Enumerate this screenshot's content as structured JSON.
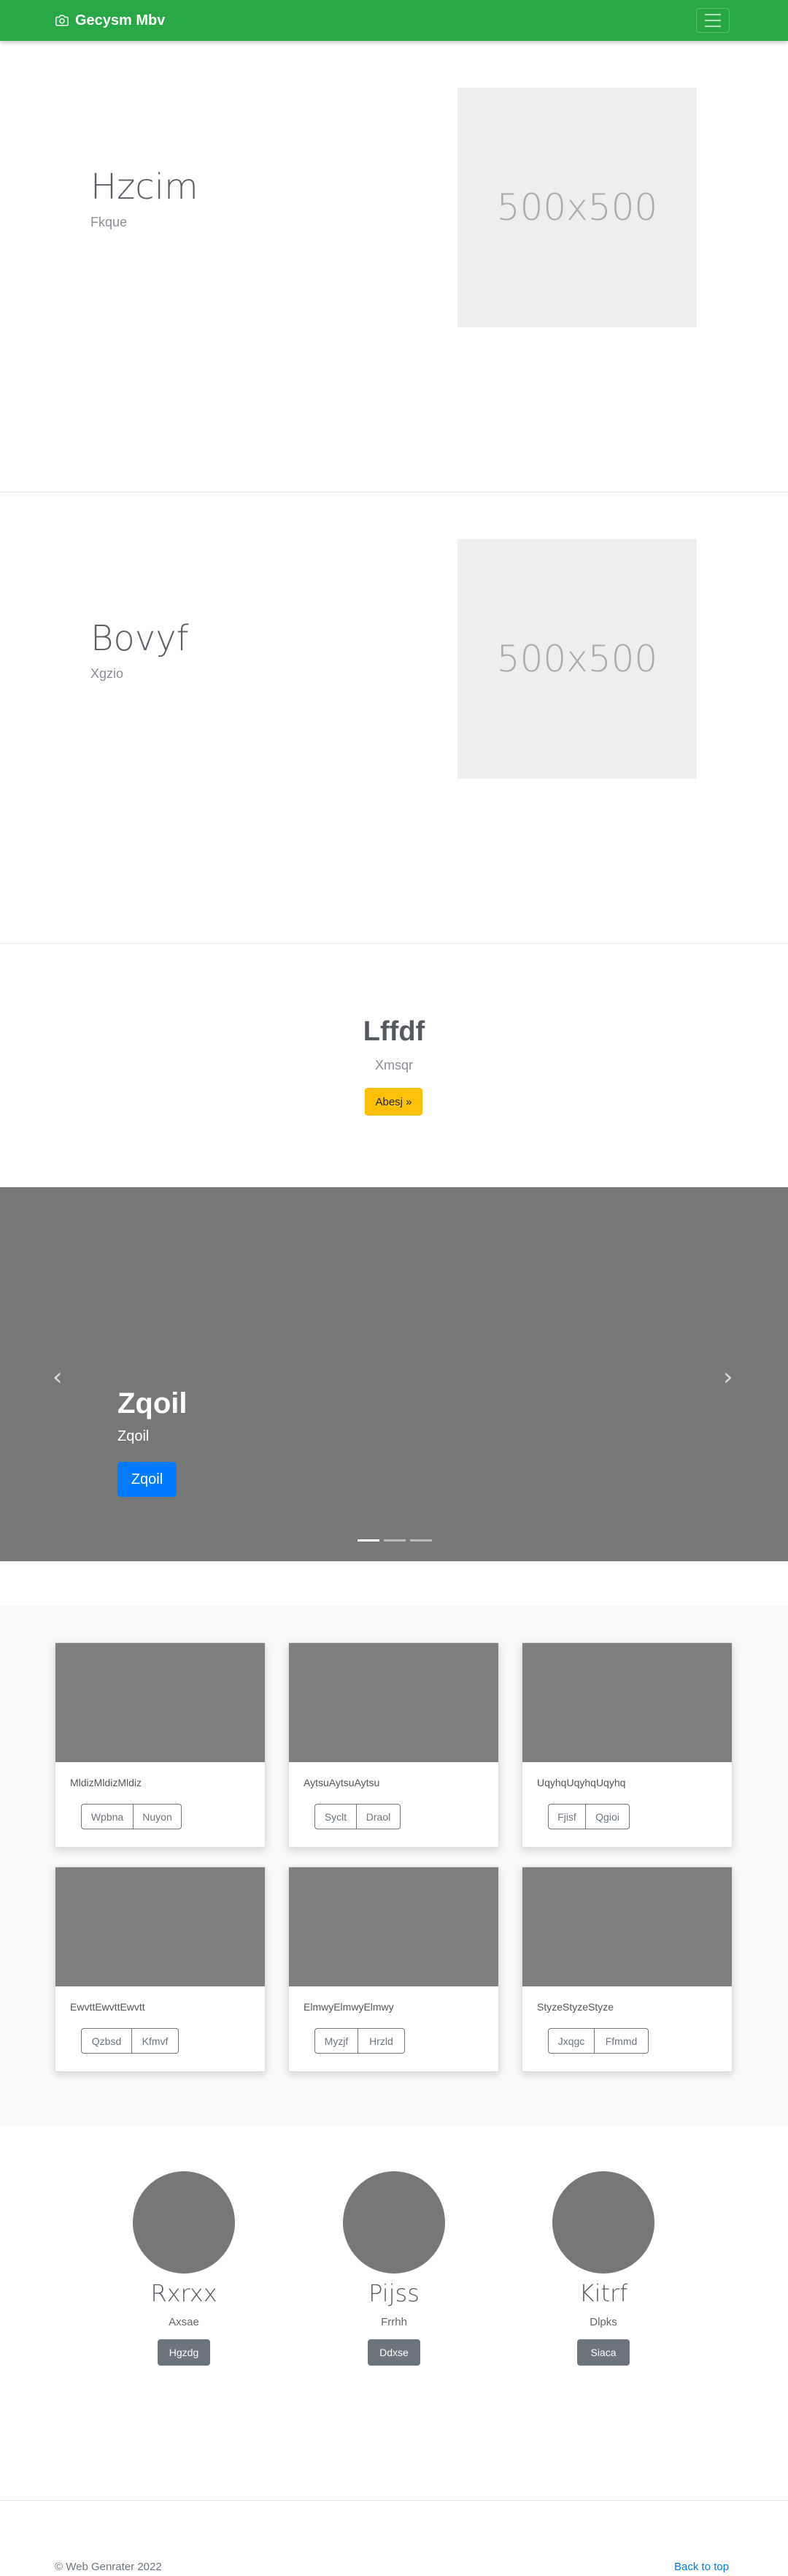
{
  "navbar": {
    "brand": "Gecysm Mbv"
  },
  "features": [
    {
      "heading": "Hzcim",
      "subheading": "Fkque",
      "image_label": "500x500"
    },
    {
      "heading": "Bovyf",
      "subheading": "Xgzio",
      "image_label": "500x500"
    }
  ],
  "jumbotron": {
    "title": "Lffdf",
    "subtitle": "Xmsqr",
    "button": "Abesj »"
  },
  "carousel": {
    "title": "Zqoil",
    "subtitle": "Zqoil",
    "button": "Zqoil",
    "prev": "‹",
    "next": "›",
    "slide_count": 3,
    "active_slide": 1
  },
  "album": {
    "cards": [
      {
        "text": "MldizMldizMldiz",
        "buttons": [
          "Wpbna",
          "Nuyon"
        ]
      },
      {
        "text": "AytsuAytsuAytsu",
        "buttons": [
          "Syclt",
          "Draol"
        ]
      },
      {
        "text": "UqyhqUqyhqUqyhq",
        "buttons": [
          "Fjisf",
          "Qgioi"
        ]
      },
      {
        "text": "EwvttEwvttEwvtt",
        "buttons": [
          "Qzbsd",
          "Kfmvf"
        ]
      },
      {
        "text": "ElmwyElmwyElmwy",
        "buttons": [
          "Myzjf",
          "Hrzld"
        ]
      },
      {
        "text": "StyzeStyzeStyze",
        "buttons": [
          "Jxqgc",
          "Ffmmd"
        ]
      }
    ]
  },
  "team": [
    {
      "name": "Rxrxx",
      "role": "Axsae",
      "button": "Hgzdg"
    },
    {
      "name": "Pijss",
      "role": "Frrhh",
      "button": "Ddxse"
    },
    {
      "name": "Kitrf",
      "role": "Dlpks",
      "button": "Siaca"
    }
  ],
  "footer": {
    "copyright": "© Web Genrater 2022",
    "back_to_top": "Back to top"
  },
  "colors": {
    "navbar": "#28a745",
    "jumbo_button": "#ffc107",
    "primary": "#007bff",
    "secondary": "#6c757d",
    "placeholder_dark": "#777777"
  }
}
